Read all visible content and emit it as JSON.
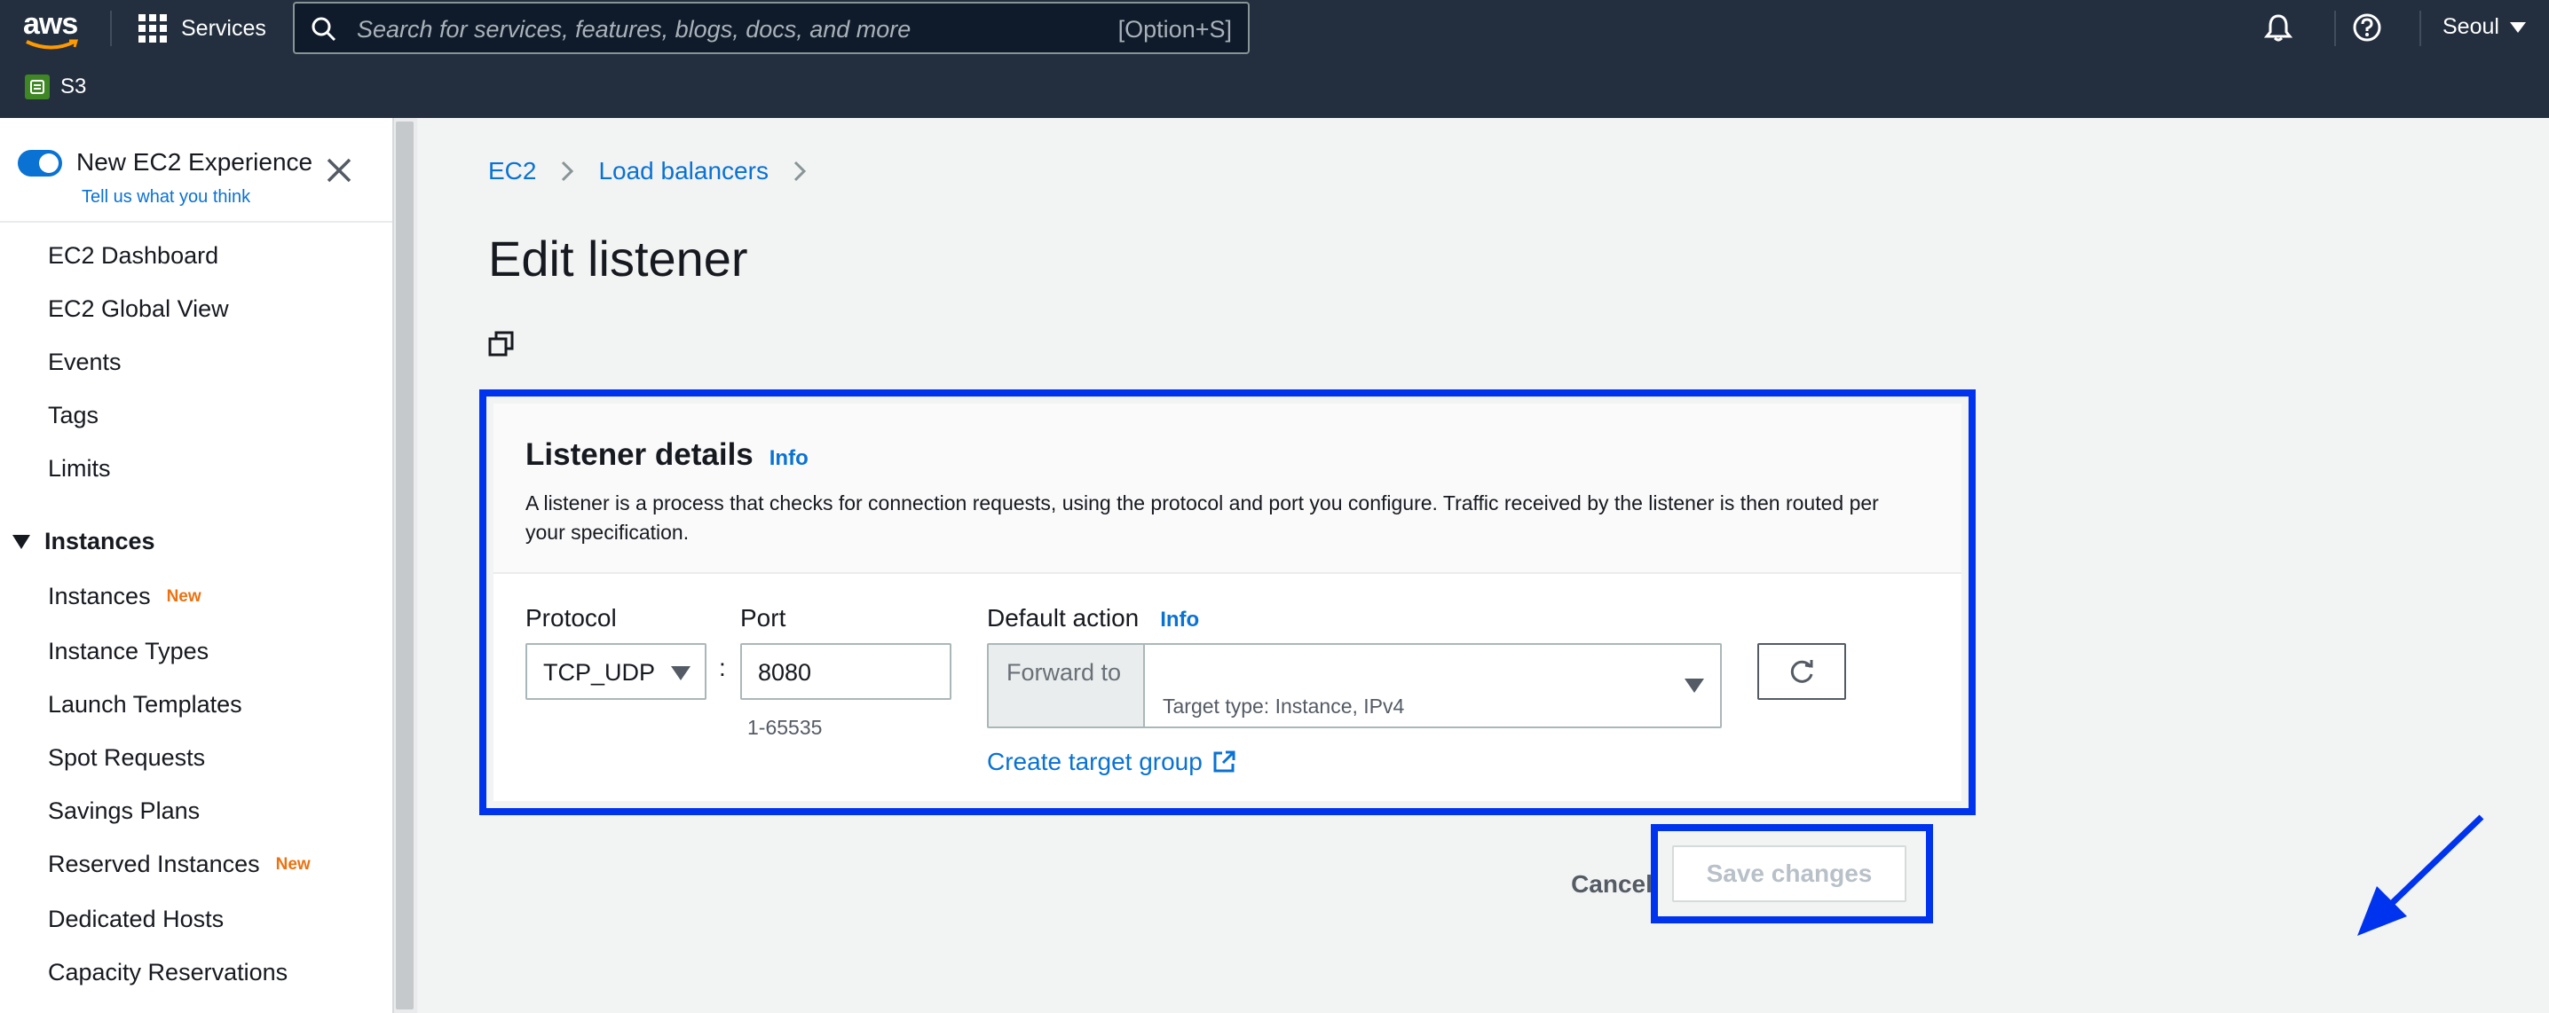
{
  "topnav": {
    "logo_text": "aws",
    "services_label": "Services",
    "search_placeholder": "Search for services, features, blogs, docs, and more",
    "search_shortcut": "[Option+S]",
    "region": "Seoul",
    "favorite_service": "S3"
  },
  "sidebar": {
    "toggle_label": "New EC2 Experience",
    "toggle_sub": "Tell us what you think",
    "items": [
      {
        "label": "EC2 Dashboard",
        "badge": ""
      },
      {
        "label": "EC2 Global View",
        "badge": ""
      },
      {
        "label": "Events",
        "badge": ""
      },
      {
        "label": "Tags",
        "badge": ""
      },
      {
        "label": "Limits",
        "badge": ""
      }
    ],
    "section": "Instances",
    "section_items": [
      {
        "label": "Instances",
        "badge": "New"
      },
      {
        "label": "Instance Types",
        "badge": ""
      },
      {
        "label": "Launch Templates",
        "badge": ""
      },
      {
        "label": "Spot Requests",
        "badge": ""
      },
      {
        "label": "Savings Plans",
        "badge": ""
      },
      {
        "label": "Reserved Instances",
        "badge": "New"
      },
      {
        "label": "Dedicated Hosts",
        "badge": ""
      },
      {
        "label": "Capacity Reservations",
        "badge": ""
      }
    ]
  },
  "breadcrumb": [
    "EC2",
    "Load balancers"
  ],
  "page_title": "Edit listener",
  "panel": {
    "title": "Listener details",
    "info": "Info",
    "description": "A listener is a process that checks for connection requests, using the protocol and port you configure. Traffic received by the listener is then routed per your specification.",
    "protocol_label": "Protocol",
    "protocol_value": "TCP_UDP",
    "port_label": "Port",
    "port_value": "8080",
    "port_hint": "1-65535",
    "default_action_label": "Default action",
    "default_action_info": "Info",
    "forward_to": "Forward to",
    "target_hint": "Target type: Instance, IPv4",
    "create_target_group": "Create target group"
  },
  "actions": {
    "cancel": "Cancel",
    "save": "Save changes"
  },
  "colors": {
    "nav_bg": "#232f3e",
    "link": "#0972d3",
    "highlight": "#0033ee"
  }
}
